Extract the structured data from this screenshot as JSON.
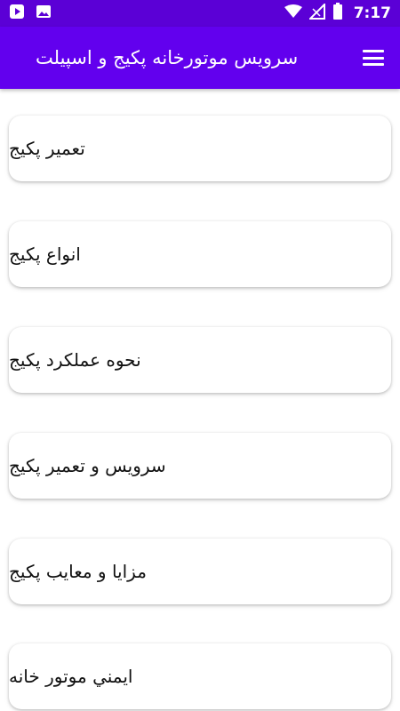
{
  "status_bar": {
    "time": "7:17",
    "left_icons": [
      "play-shield-icon",
      "image-icon"
    ],
    "right_icons": [
      "wifi-icon",
      "signal-icon",
      "battery-icon"
    ]
  },
  "app_bar": {
    "title": "سرویس موتورخانه پکیج و اسپیلت",
    "menu_icon": "hamburger-menu-icon",
    "color": "#6200ee"
  },
  "menu_items": [
    {
      "label": "تعمیر پکیج"
    },
    {
      "label": "انواع پکیج"
    },
    {
      "label": "نحوه عملکرد پکیج"
    },
    {
      "label": "سرویس و تعمیر پکیج"
    },
    {
      "label": "مزایا و معایب پکیج"
    },
    {
      "label": "ايمني موتور خانه"
    }
  ]
}
